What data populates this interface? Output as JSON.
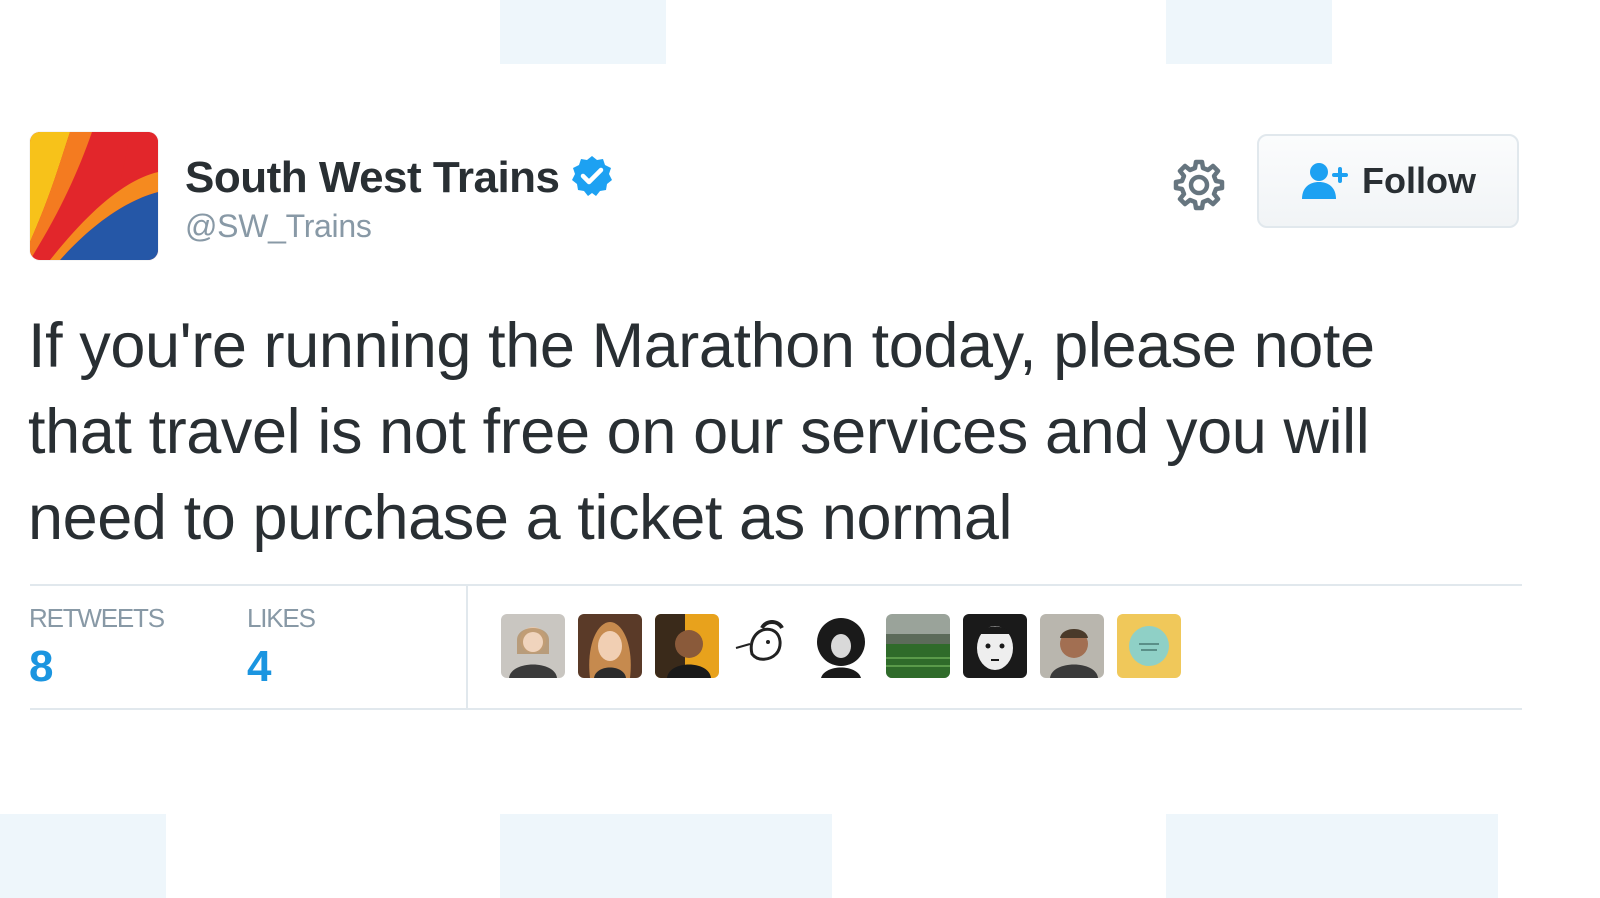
{
  "tweet": {
    "author": {
      "display_name": "South West Trains",
      "handle": "@SW_Trains",
      "verified": true,
      "avatar_icon": "south-west-trains-logo-icon"
    },
    "actions": {
      "follow_label": "Follow",
      "follow_icon": "add-user-icon",
      "settings_icon": "gear-icon"
    },
    "text": "If you're running the Marathon today, please note\nthat travel is not free on our services and you will\nneed to purchase a ticket as normal",
    "stats": {
      "retweets_label": "RETWEETS",
      "retweets_value": "8",
      "likes_label": "LIKES",
      "likes_value": "4"
    },
    "likers": [
      {
        "icon": "liker-avatar-1"
      },
      {
        "icon": "liker-avatar-2"
      },
      {
        "icon": "liker-avatar-3"
      },
      {
        "icon": "liker-avatar-4"
      },
      {
        "icon": "liker-avatar-5"
      },
      {
        "icon": "liker-avatar-6"
      },
      {
        "icon": "liker-avatar-7"
      },
      {
        "icon": "liker-avatar-8"
      },
      {
        "icon": "liker-avatar-9"
      }
    ]
  },
  "colors": {
    "link_blue": "#1b95e0",
    "verified_blue": "#1da1f2",
    "muted_gray": "#8899a6",
    "text_dark": "#292f33",
    "divider": "#e1e8ed"
  }
}
